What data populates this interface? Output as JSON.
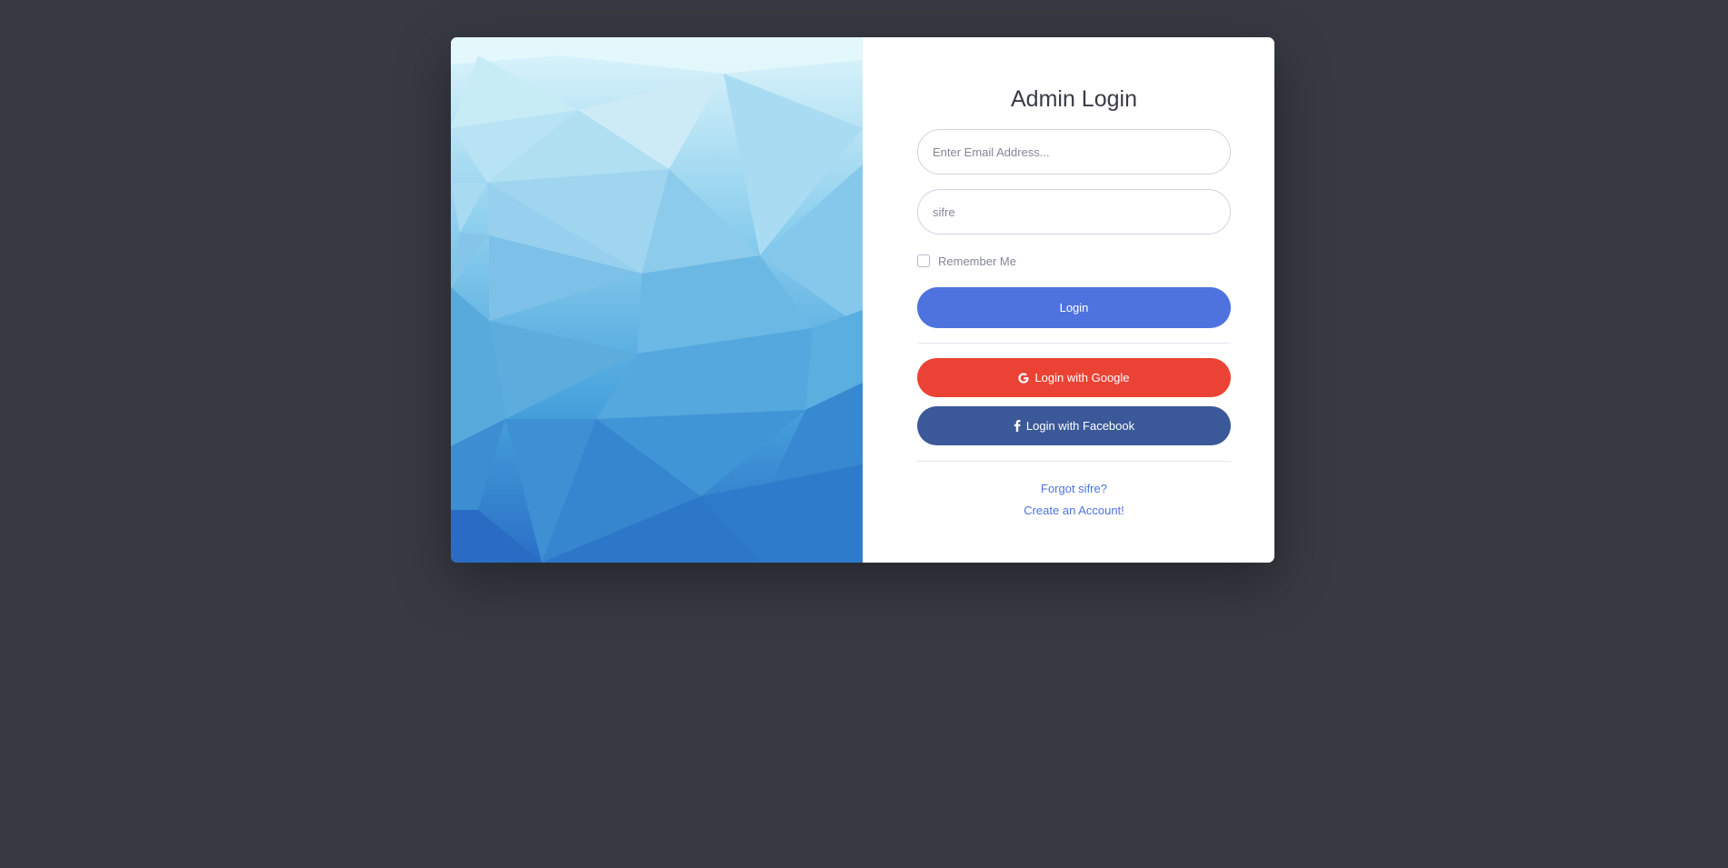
{
  "login_form": {
    "title": "Admin Login",
    "email_placeholder": "Enter Email Address...",
    "password_placeholder": "sifre",
    "remember_label": "Remember Me",
    "login_button": "Login",
    "google_button": "Login with Google",
    "facebook_button": "Login with Facebook",
    "forgot_link": "Forgot sifre?",
    "create_account_link": "Create an Account!"
  },
  "icons": {
    "google": "google-icon",
    "facebook": "facebook-icon",
    "checkbox": "checkbox-unchecked"
  },
  "colors": {
    "page_background": "#373a42",
    "primary": "#4e73df",
    "google": "#ea4335",
    "facebook": "#3b5998"
  }
}
